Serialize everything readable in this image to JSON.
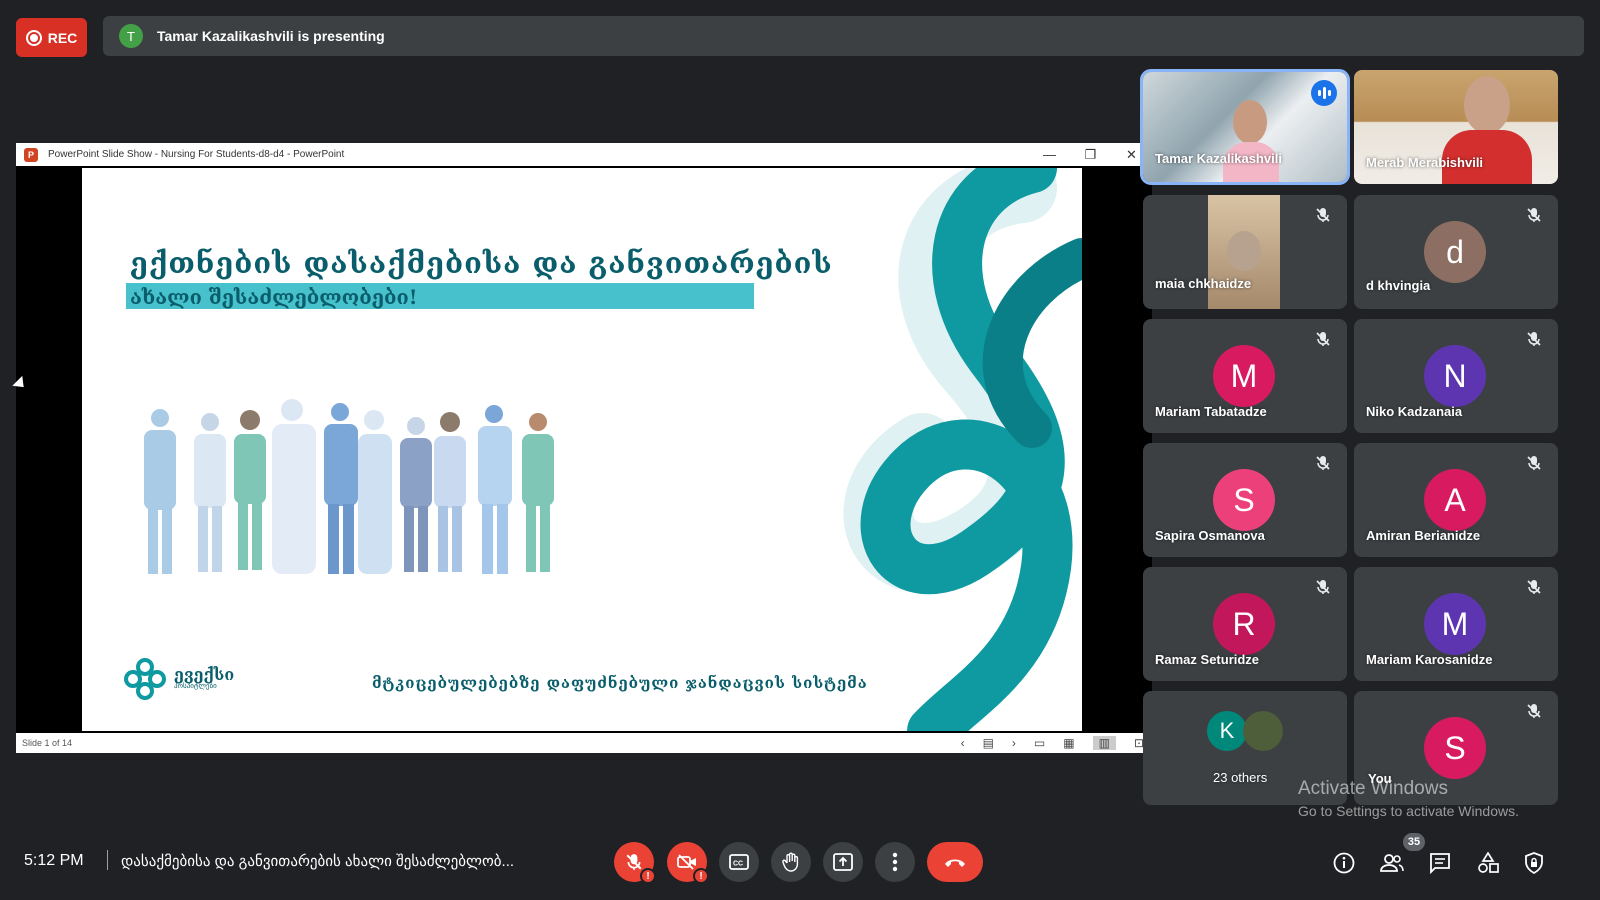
{
  "recording": {
    "label": "REC"
  },
  "presenter": {
    "initial": "T",
    "text": "Tamar Kazalikashvili is presenting"
  },
  "ppt_window": {
    "app_icon": "P",
    "title": "PowerPoint Slide Show  -  Nursing For  Students-d8-d4  -  PowerPoint",
    "status": "Slide 1 of 14"
  },
  "slide": {
    "title": "ექთნების დასაქმებისა და განვითარების",
    "subtitle": "ახალი შესაძლებლობები!",
    "footer": "მტკიცებულებებზე დაფუძნებული ჯანდაცვის სისტემა",
    "brand_name": "ევექსი",
    "brand_sub": "ჰოსპიტლები",
    "accent": "#0e9aa0"
  },
  "participants": [
    {
      "name": "Tamar Kazalikashvili",
      "type": "video",
      "speaking": true
    },
    {
      "name": "Merab Merabishvili",
      "type": "video"
    },
    {
      "name": "maia chkhaidze",
      "type": "video-small",
      "muted": true
    },
    {
      "name": "d khvingia",
      "initial": "d",
      "color": "#8d6e63",
      "muted": true
    },
    {
      "name": "Mariam Tabatadze",
      "initial": "M",
      "color": "#d81b60",
      "muted": true
    },
    {
      "name": "Niko Kadzanaia",
      "initial": "N",
      "color": "#5e35b1",
      "muted": true
    },
    {
      "name": "Sapira Osmanova",
      "initial": "S",
      "color": "#ec407a",
      "muted": true
    },
    {
      "name": "Amiran Berianidze",
      "initial": "A",
      "color": "#d81b60",
      "muted": true
    },
    {
      "name": "Ramaz Seturidze",
      "initial": "R",
      "color": "#c2185b",
      "muted": true
    },
    {
      "name": "Mariam Karosanidze",
      "initial": "M",
      "color": "#5e35b1",
      "muted": true
    },
    {
      "name": "23 others",
      "initial": "K",
      "color": "#00897b"
    },
    {
      "name": "You",
      "initial": "S",
      "color": "#d81b60",
      "muted": true
    }
  ],
  "watermark": {
    "line1": "Activate Windows",
    "line2": "Go to Settings to activate Windows."
  },
  "bottom": {
    "time": "5:12 PM",
    "meeting_title": "დასაქმებისა და განვითარების ახალი შესაძლებლობ...",
    "people_count": "35"
  }
}
